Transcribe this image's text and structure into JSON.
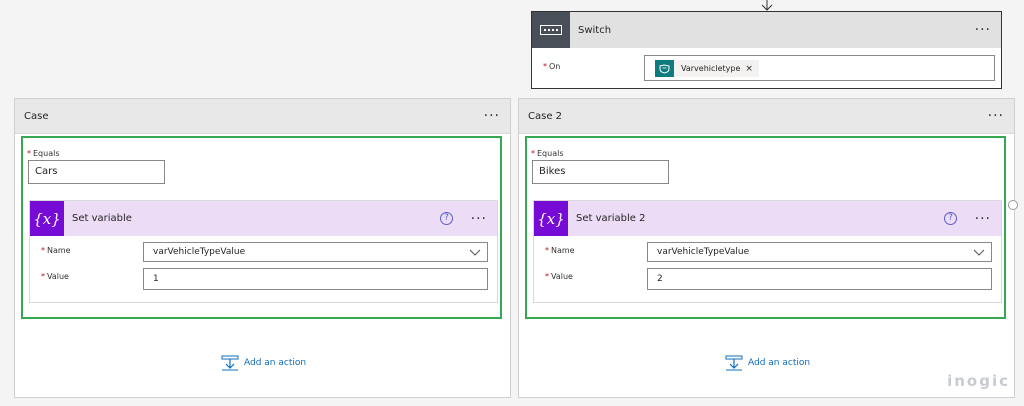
{
  "switch": {
    "title": "Switch",
    "on_label": "On",
    "token_text": "Varvehicletype",
    "token_remove": "×"
  },
  "cases": [
    {
      "title": "Case",
      "equals_label": "Equals",
      "equals_value": "Cars",
      "action": {
        "title": "Set variable",
        "name_label": "Name",
        "name_value": "varVehicleTypeValue",
        "value_label": "Value",
        "value_value": "1"
      },
      "add_action_label": "Add an action"
    },
    {
      "title": "Case 2",
      "equals_label": "Equals",
      "equals_value": "Bikes",
      "action": {
        "title": "Set variable 2",
        "name_label": "Name",
        "name_value": "varVehicleTypeValue",
        "value_label": "Value",
        "value_value": "2"
      },
      "add_action_label": "Add an action"
    }
  ],
  "common": {
    "more_glyph": "···",
    "help_glyph": "?",
    "required_star": "*",
    "variable_icon_text": "{x}"
  },
  "logo_text": "inogic",
  "colors": {
    "success_border": "#36a852",
    "variable_purple": "#770bd6",
    "variable_header": "#ecdcf6",
    "token_teal": "#0f7b7d",
    "link_blue": "#0f6cbd",
    "required_red": "#c50f1f"
  },
  "icons": {
    "switch": "switch-icon",
    "token": "expression-token-icon",
    "variable": "variable-icon",
    "help": "help-icon",
    "chevron": "chevron-down-icon",
    "add_action": "add-action-icon",
    "arrow": "arrow-down-icon"
  }
}
